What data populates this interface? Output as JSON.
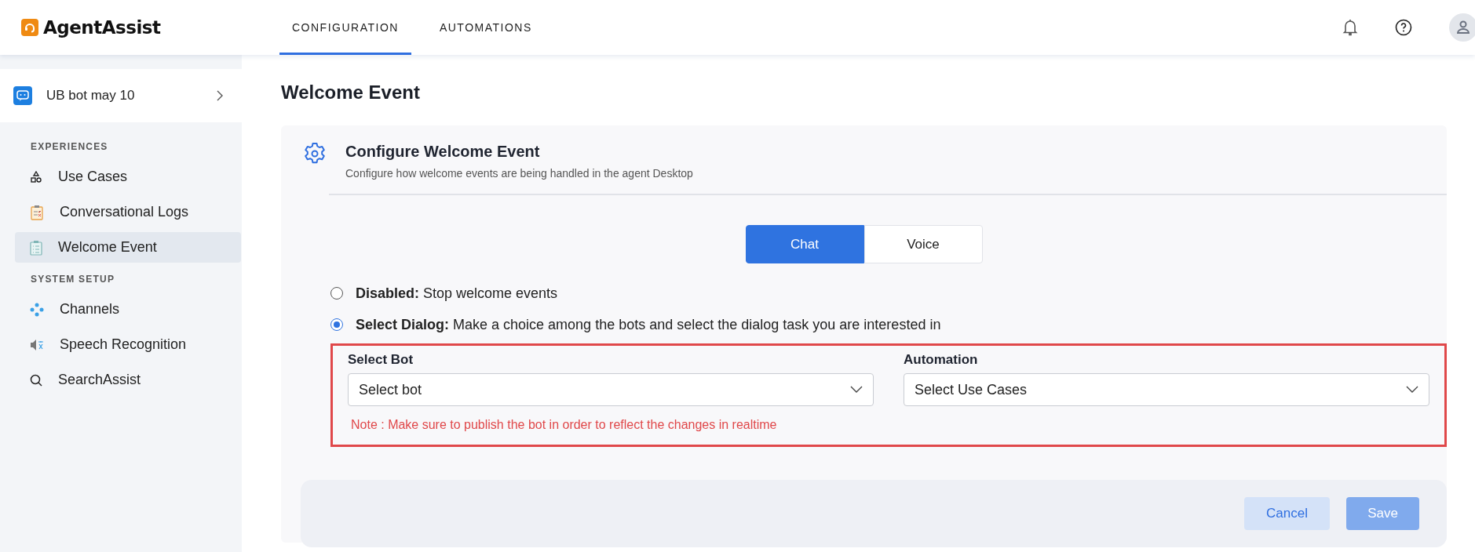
{
  "header": {
    "logo_text": "AgentAssist",
    "tabs": [
      {
        "label": "CONFIGURATION",
        "selected": true
      },
      {
        "label": "AUTOMATIONS",
        "selected": false
      }
    ]
  },
  "sidebar": {
    "bot": {
      "name": "UB bot may 10"
    },
    "sections": [
      {
        "title": "EXPERIENCES",
        "items": [
          {
            "label": "Use Cases",
            "kind": "shapes",
            "selected": false
          },
          {
            "label": "Conversational Logs",
            "kind": "clipboard",
            "selected": false
          },
          {
            "label": "Welcome Event",
            "kind": "checklist",
            "selected": true
          }
        ]
      },
      {
        "title": "SYSTEM SETUP",
        "items": [
          {
            "label": "Channels",
            "kind": "channels",
            "selected": false
          },
          {
            "label": "Speech Recognition",
            "kind": "speech",
            "selected": false
          },
          {
            "label": "SearchAssist",
            "kind": "search",
            "selected": false
          }
        ]
      }
    ]
  },
  "page": {
    "title": "Welcome Event",
    "card": {
      "title": "Configure Welcome Event",
      "subtitle": "Configure how welcome events are being handled in the agent Desktop",
      "segments": [
        {
          "label": "Chat",
          "selected": true
        },
        {
          "label": "Voice",
          "selected": false
        }
      ],
      "options": [
        {
          "label": "**Disabled:** Stop welcome events",
          "selected": false
        },
        {
          "label": "**Select Dialog:** Make a choice among the bots and select the dialog task you are interested in",
          "selected": true
        }
      ],
      "form": {
        "highlighted": true,
        "fields": [
          {
            "label": "Select Bot",
            "placeholder": "Select bot"
          },
          {
            "label": "Automation",
            "placeholder": "Select Use Cases"
          }
        ],
        "note": "Note : Make sure to publish the bot in order to reflect the changes in realtime"
      },
      "buttons": [
        {
          "label": "Cancel",
          "kind": "secondary",
          "disabled": false
        },
        {
          "label": "Save",
          "kind": "primary",
          "disabled": true
        }
      ]
    }
  }
}
